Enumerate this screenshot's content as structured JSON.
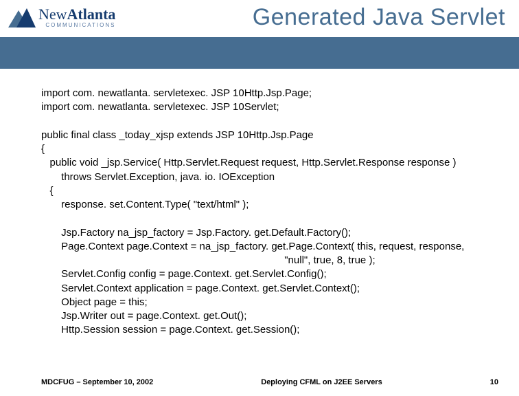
{
  "logo": {
    "name_prefix": "New",
    "name_main": "Atlanta",
    "sub": "COMMUNICATIONS"
  },
  "title": "Generated Java Servlet",
  "code": {
    "l1": "import com. newatlanta. servletexec. JSP 10Http.Jsp.Page;",
    "l2": "import com. newatlanta. servletexec. JSP 10Servlet;",
    "l3": "",
    "l4": "public final class _today_xjsp extends JSP 10Http.Jsp.Page",
    "l5": "{",
    "l6": "   public void _jsp.Service( Http.Servlet.Request request, Http.Servlet.Response response )",
    "l7": "       throws Servlet.Exception, java. io. IOException",
    "l8": "   {",
    "l9": "       response. set.Content.Type( \"text/html\" );",
    "l10": "",
    "l11": "       Jsp.Factory na_jsp_factory = Jsp.Factory. get.Default.Factory();",
    "l12": "       Page.Context page.Context = na_jsp_factory. get.Page.Context( this, request, response,",
    "l13": "                                                                                     \"null\", true, 8, true );",
    "l14": "       Servlet.Config config = page.Context. get.Servlet.Config();",
    "l15": "       Servlet.Context application = page.Context. get.Servlet.Context();",
    "l16": "       Object page = this;",
    "l17": "       Jsp.Writer out = page.Context. get.Out();",
    "l18": "       Http.Session session = page.Context. get.Session();"
  },
  "footer": {
    "left": "MDCFUG – September 10, 2002",
    "center": "Deploying CFML on J2EE Servers",
    "right": "10"
  }
}
